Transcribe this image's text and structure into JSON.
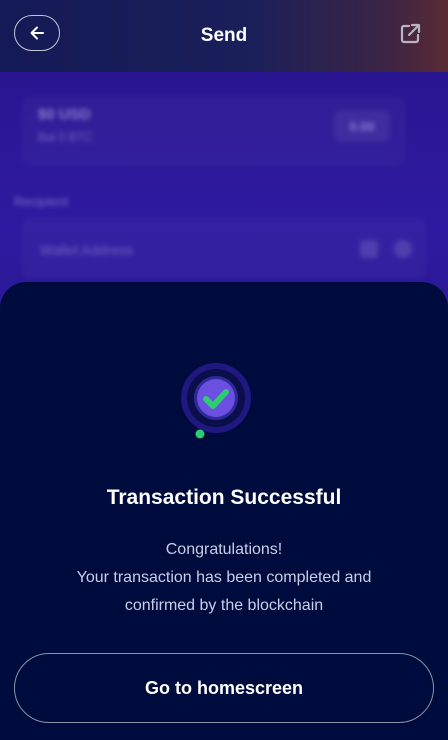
{
  "header": {
    "title": "Send",
    "back_icon": "arrow-left-icon",
    "share_icon": "external-link-icon"
  },
  "background_form": {
    "amount": "$0 USD",
    "amount_sub": "Bal 0 BTC",
    "max_label": "0.00",
    "recipient_label": "Recipient",
    "recipient_placeholder": "Wallet Address"
  },
  "success": {
    "icon": "check-circle-icon",
    "title": "Transaction Successful",
    "message_line1": "Congratulations!",
    "message_line2": "Your transaction has been completed and",
    "message_line3": "confirmed by the blockchain"
  },
  "actions": {
    "home_label": "Go to homescreen"
  },
  "colors": {
    "sheet_bg": "#000b3d",
    "accent_purple": "#6a4fe0",
    "success_green": "#2ecc71"
  }
}
